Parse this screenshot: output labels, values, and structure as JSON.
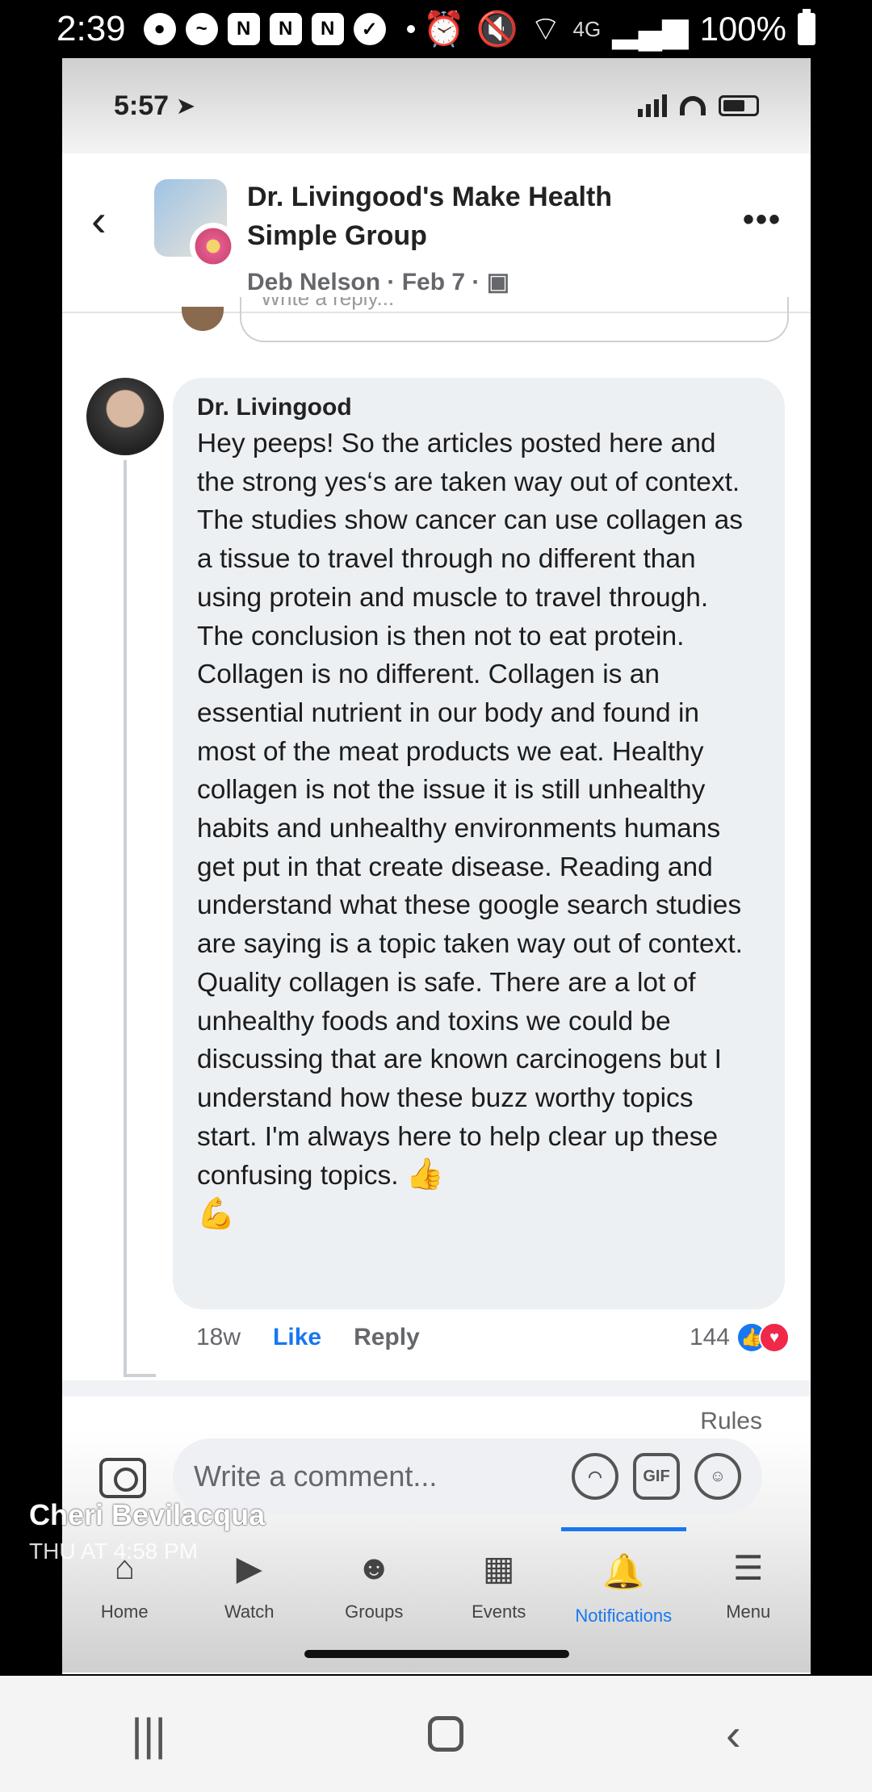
{
  "outer_status": {
    "time": "2:39",
    "network": "4G",
    "battery": "100%"
  },
  "inner_status": {
    "time": "5:57",
    "nav_arrow": "➤"
  },
  "header": {
    "back_icon": "‹",
    "title": "Dr. Livingood's Make Health Simple Group",
    "meta": "Deb Nelson · Feb 7 · ",
    "more_icon": "•••"
  },
  "reply_placeholder": "Write a reply...",
  "comment": {
    "author": "Dr. Livingood",
    "text": "Hey peeps! So the articles posted here and the strong yes‘s are taken way out of context. The studies show cancer can use collagen as a tissue to travel through no different than using protein and muscle to travel through. The conclusion is then not to eat protein. Collagen is no different. Collagen is an essential nutrient in our body and found in most of the meat products we eat. Healthy collagen is not the issue it is still unhealthy habits and unhealthy environments humans get put in that create disease. Reading and understand what these google search studies are saying is a topic taken way out of context. Quality collagen is safe. There are a lot of unhealthy foods and toxins we could be discussing that are known carcinogens but I understand how these buzz worthy topics start. I'm always here to help clear up these confusing topics.",
    "emoji_thumb": "👍",
    "emoji_muscle": "💪",
    "age": "18w",
    "like_label": "Like",
    "reply_label": "Reply",
    "reaction_count": "144"
  },
  "rules_label": "Rules",
  "composer": {
    "placeholder": "Write a comment...",
    "gif_label": "GIF"
  },
  "nav": {
    "home": "Home",
    "watch": "Watch",
    "groups": "Groups",
    "events": "Events",
    "notifications": "Notifications",
    "menu": "Menu"
  },
  "overlay": {
    "name": "Cheri Bevilacqua",
    "time": "THU AT 4:58 PM"
  },
  "colors": {
    "accent": "#1877f2",
    "love": "#f0284a"
  }
}
